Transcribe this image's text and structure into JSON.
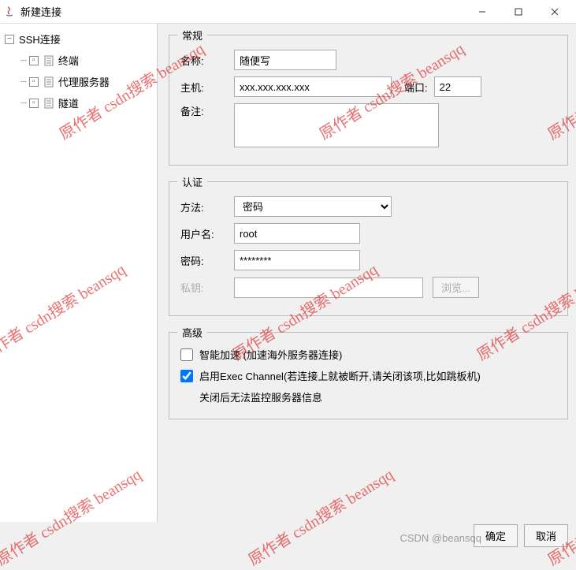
{
  "window": {
    "title": "新建连接"
  },
  "sidebar": {
    "root": "SSH连接",
    "items": [
      "终端",
      "代理服务器",
      "隧道"
    ]
  },
  "sections": {
    "general": {
      "legend": "常规",
      "name_label": "名称:",
      "name_value": "随便写",
      "host_label": "主机:",
      "host_value": "xxx.xxx.xxx.xxx",
      "port_label": "端口:",
      "port_value": "22",
      "remark_label": "备注:",
      "remark_value": ""
    },
    "auth": {
      "legend": "认证",
      "method_label": "方法:",
      "method_value": "密码",
      "user_label": "用户名:",
      "user_value": "root",
      "pass_label": "密码:",
      "pass_value": "********",
      "key_label": "私钥:",
      "key_value": "",
      "browse_label": "浏览..."
    },
    "advanced": {
      "legend": "高级",
      "smart_accel": "智能加速 (加速海外服务器连接)",
      "exec_channel": "启用Exec Channel(若连接上就被断开,请关闭该项,比如跳板机)",
      "exec_note": "关闭后无法监控服务器信息"
    }
  },
  "footer": {
    "ok": "确定",
    "cancel": "取消"
  },
  "watermark": {
    "text": "原作者 csdn搜索 beansqq",
    "credit": "CSDN @beansqq"
  }
}
